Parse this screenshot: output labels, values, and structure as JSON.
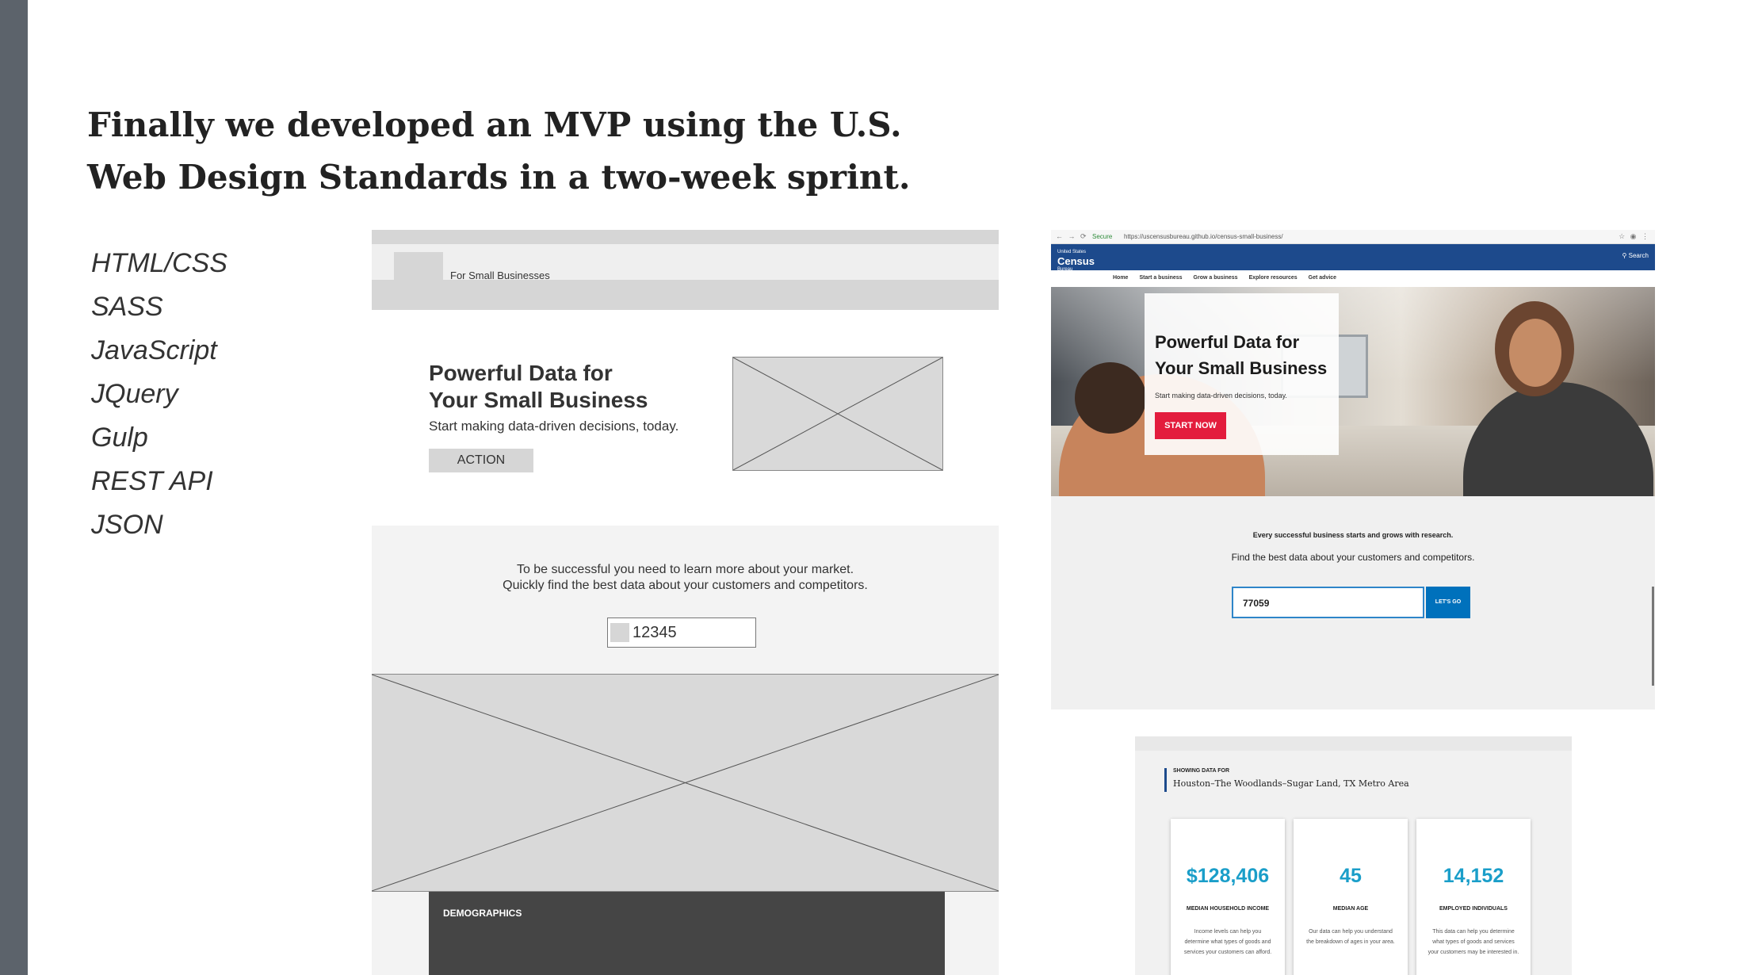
{
  "slide": {
    "title_line1": "Finally we developed an MVP using the U.S.",
    "title_line2": "Web Design Standards in a two-week sprint."
  },
  "tech_stack": [
    "HTML/CSS",
    "SASS",
    "JavaScript",
    "JQuery",
    "Gulp",
    "REST API",
    "JSON"
  ],
  "wireframe": {
    "brand_text": "For Small Businesses",
    "hero_title_line1": "Powerful Data for",
    "hero_title_line2": "Your Small Business",
    "hero_subtitle": "Start making data-driven decisions, today.",
    "action_label": "ACTION",
    "section_line1": "To be successful you need to learn more about your market.",
    "section_line2": "Quickly find the best data about your customers and competitors.",
    "zip_value": "12345",
    "demographics_label": "DEMOGRAPHICS"
  },
  "screenshot_site": {
    "browser_secure": "Secure",
    "browser_url": "https://uscensusbureau.github.io/census-small-business/",
    "logo_small": "United States",
    "logo_text": "Census",
    "logo_sub": "Bureau",
    "search_label": "Search",
    "nav_items": [
      "Home",
      "Start a business",
      "Grow a business",
      "Explore resources",
      "Get advice"
    ],
    "hero_title_line1": "Powerful Data for",
    "hero_title_line2": "Your Small Business",
    "hero_subtitle": "Start making data-driven decisions, today.",
    "start_button": "START NOW",
    "line1": "Every successful business starts and grows with research.",
    "line2": "Find the best data about your customers and competitors.",
    "zip_value": "77059",
    "go_button": "LET'S GO"
  },
  "screenshot_data": {
    "showing_label": "SHOWING DATA FOR",
    "area_name": "Houston–The Woodlands–Sugar Land, TX Metro Area",
    "cards": [
      {
        "value": "$128,406",
        "label": "MEDIAN HOUSEHOLD INCOME",
        "desc": "Income levels can help you determine what types of goods and services your customers can afford."
      },
      {
        "value": "45",
        "label": "MEDIAN AGE",
        "desc": "Our data can help you understand the breakdown of ages in your area."
      },
      {
        "value": "14,152",
        "label": "EMPLOYED INDIVIDUALS",
        "desc": "This data can help you determine what types of goods and services your customers may be interested in."
      }
    ]
  },
  "colors": {
    "sidebar": "#5c636b",
    "census_blue": "#1d4a8c",
    "start_red": "#e31c3d",
    "go_blue": "#0071bc",
    "stat_cyan": "#1a9ec9"
  }
}
